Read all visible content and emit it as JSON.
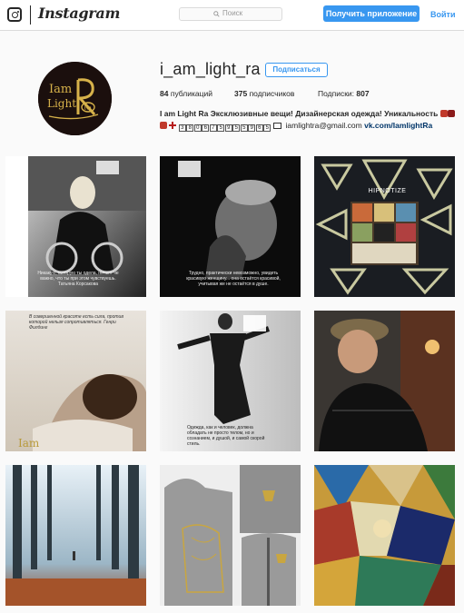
{
  "nav": {
    "wordmark": "Instagram",
    "search_placeholder": "Поиск",
    "get_app_label": "Получить приложение",
    "login_label": "Войти"
  },
  "profile": {
    "username": "i_am_light_ra",
    "follow_label": "Подписаться",
    "avatar_text": {
      "line1": "Iam",
      "line2": "Light",
      "badge": "Ra"
    },
    "stats": {
      "posts_count": "84",
      "posts_label": "публикаций",
      "followers_count": "375",
      "followers_label": "подписчиков",
      "following_label": "Подписки:",
      "following_count": "807"
    },
    "bio_line1": "I am Light Ra Эксклюзивные вещи! Дизайнерская одежда! Уникальность",
    "bio_phone_digits": [
      "3",
      "8",
      "0",
      "6",
      "7",
      "5",
      "9",
      "5",
      "5",
      "9",
      "6",
      "5"
    ],
    "bio_email": "iamlightra@gmail.com",
    "bio_link": "vk.com/IamlightRa"
  },
  "posts": [
    {
      "caption": "Никакую, которую ты одела, ничего не важно, что ты при этом чувствуешь. Татьяна Корсакова"
    },
    {
      "caption": "Трудно, практически невозможно, увидеть красивую женщину... она остаётся красивой, учитывая же не остаётся в душе."
    },
    {
      "caption": "HIPNOTIZE"
    },
    {
      "caption": "В совершенной красоте есть сила, против которой нельзя сопротивляться. Генри Филдинг"
    },
    {
      "caption": "Одежда, как и человек, должна обладать не просто телом, но и сознанием, и душой, и самой скорой стиль."
    },
    {
      "caption": ""
    },
    {
      "caption": ""
    },
    {
      "caption": ""
    },
    {
      "caption": ""
    }
  ]
}
